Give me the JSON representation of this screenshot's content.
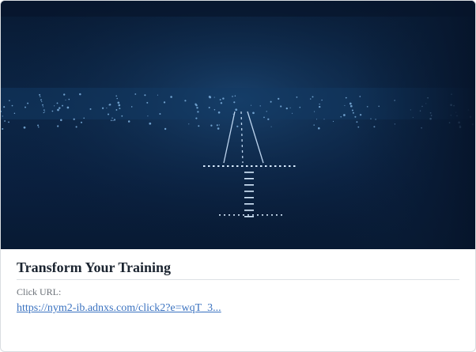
{
  "card": {
    "image_alt": "runway-at-night-photo",
    "title": "Transform Your Training",
    "click_url_label": "Click URL:",
    "click_url": "https://nym2-ib.adnxs.com/click2?e=wqT_3..."
  },
  "colors": {
    "title": "#1b2430",
    "label": "#6b7178",
    "link": "#3a72c0",
    "hero_tint": "#0c2647"
  }
}
